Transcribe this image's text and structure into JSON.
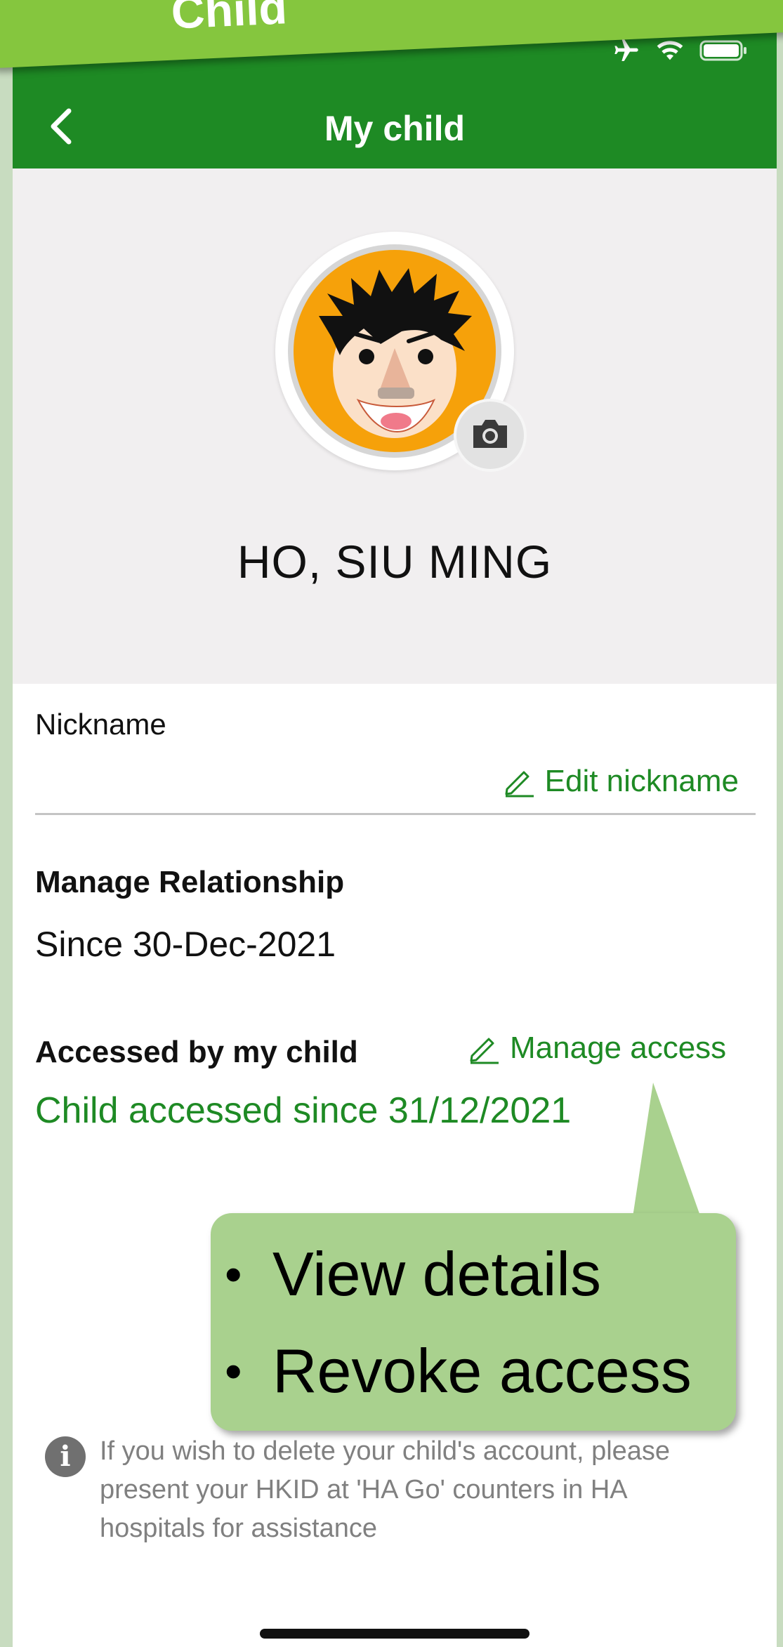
{
  "banner": {
    "text": "Child"
  },
  "navbar": {
    "title": "My child"
  },
  "profile": {
    "name": "HO, SIU MING"
  },
  "nickname": {
    "label": "Nickname",
    "edit_label": "Edit nickname"
  },
  "relationship": {
    "label": "Manage Relationship",
    "since": "Since 30-Dec-2021"
  },
  "access": {
    "label": "Accessed by my child",
    "manage_label": "Manage access",
    "since": "Child accessed since 31/12/2021"
  },
  "callout": {
    "items": [
      "View details",
      "Revoke access"
    ]
  },
  "info": {
    "text": "If you wish to delete your child's account, please present your HKID at 'HA Go' counters in HA hospitals for assistance"
  },
  "colors": {
    "brand_green": "#1e8a24",
    "callout_green": "#a9d18e",
    "banner_green": "#85c63e"
  },
  "icons": [
    "back-icon",
    "airplane-icon",
    "wifi-icon",
    "battery-icon",
    "camera-icon",
    "pencil-icon",
    "info-icon"
  ]
}
